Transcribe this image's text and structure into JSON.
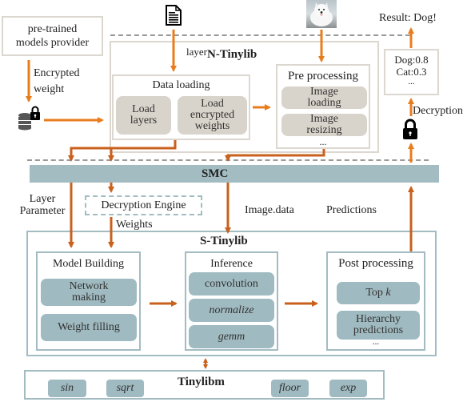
{
  "provider": {
    "line1": "pre-trained",
    "line2": "models provider"
  },
  "encrypted_weight": {
    "line1": "Encrypted",
    "line2": "weight"
  },
  "result_label": "Result: Dog!",
  "predictions_box": {
    "line1": "Dog:0.8",
    "line2": "Cat:0.3",
    "line3": "..."
  },
  "decryption_label": "Decryption",
  "n_tinylib": {
    "prefix": "layer",
    "title": "N-Tinylib"
  },
  "data_loading": {
    "title": "Data loading",
    "items": [
      {
        "line1": "Load",
        "line2": "layers"
      },
      {
        "line1": "Load",
        "line2": "encrypted",
        "line3": "weights"
      }
    ]
  },
  "pre_processing": {
    "title": "Pre processing",
    "items": [
      {
        "line1": "Image",
        "line2": "loading"
      },
      {
        "line1": "Image",
        "line2": "resizing"
      }
    ],
    "ellipsis": "..."
  },
  "smc": {
    "title": "SMC"
  },
  "layer_parameter": {
    "line1": "Layer",
    "line2": "Parameter"
  },
  "decryption_engine": "Decryption Engine",
  "weights_label": "Weights",
  "image_data_label": "Image.data",
  "predictions_label": "Predictions",
  "s_tinylib": {
    "title": "S-Tinylib"
  },
  "model_building": {
    "title": "Model Building",
    "items": [
      {
        "line1": "Network",
        "line2": "making"
      },
      {
        "line1": "Weight filling"
      }
    ]
  },
  "inference": {
    "title": "Inference",
    "items": [
      "convolution",
      "normalize",
      "gemm"
    ]
  },
  "post_processing": {
    "title": "Post processing",
    "items": [
      {
        "prefix": "Top ",
        "var": "k"
      },
      {
        "line1": "Hierarchy",
        "line2": "predictions"
      }
    ],
    "ellipsis": "..."
  },
  "tinylibm": {
    "title": "Tinylibm",
    "functions": [
      "sin",
      "sqrt",
      "floor",
      "exp"
    ]
  },
  "icons": {
    "document": "document-icon",
    "dog_image": "dog-photo",
    "database_lock": "encrypted-database-icon",
    "lock": "lock-icon"
  },
  "colors": {
    "arrow_orange": "#e87d1e",
    "arrow_dark_orange": "#c9601c",
    "smc_bar": "#a2bcc2",
    "beige_pill": "#d9d4cb",
    "blue_pill": "#9fbac0"
  }
}
